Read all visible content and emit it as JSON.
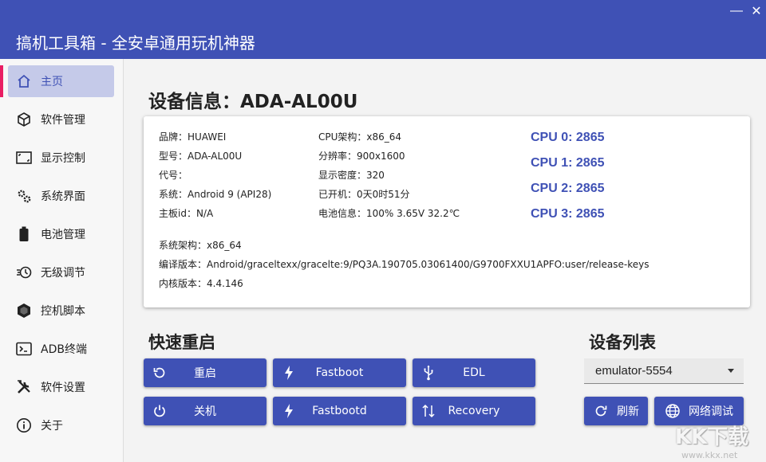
{
  "window": {
    "title": "搞机工具箱 - 全安卓通用玩机神器",
    "minimize_glyph": "—",
    "close_glyph": "✕"
  },
  "sidebar": {
    "items": [
      {
        "label": "主页",
        "icon": "home-icon",
        "active": true
      },
      {
        "label": "软件管理",
        "icon": "box-icon"
      },
      {
        "label": "显示控制",
        "icon": "screen-icon"
      },
      {
        "label": "系统界面",
        "icon": "gears-icon"
      },
      {
        "label": "电池管理",
        "icon": "battery-icon"
      },
      {
        "label": "无级调节",
        "icon": "timer-icon"
      },
      {
        "label": "控机脚本",
        "icon": "hexagon-icon"
      },
      {
        "label": "ADB终端",
        "icon": "terminal-icon"
      },
      {
        "label": "软件设置",
        "icon": "tools-icon"
      },
      {
        "label": "关于",
        "icon": "info-icon"
      }
    ]
  },
  "device": {
    "heading": "设备信息：ADA-AL00U",
    "col1": [
      "品牌：HUAWEI",
      "型号：ADA-AL00U",
      "代号：",
      "系统：Android 9 (API28)",
      "主板id：N/A"
    ],
    "col2": [
      "CPU架构：x86_64",
      "分辨率：900x1600",
      "显示密度：320",
      "已开机：0天0时51分",
      "电池信息：100%  3.65V  32.2℃"
    ],
    "cpus": [
      "CPU 0: 2865",
      "CPU 1: 2865",
      "CPU 2: 2865",
      "CPU 3: 2865"
    ],
    "extra": [
      "系统架构：x86_64",
      "编译版本：Android/graceltexx/gracelte:9/PQ3A.190705.03061400/G9700FXXU1APFO:user/release-keys",
      "内核版本：4.4.146"
    ]
  },
  "reboot": {
    "heading": "快速重启",
    "buttons": {
      "restart": "重启",
      "fastboot": "Fastboot",
      "edl": "EDL",
      "shutdown": "关机",
      "fastbootd": "Fastbootd",
      "recovery": "Recovery"
    }
  },
  "devices": {
    "heading": "设备列表",
    "selected": "emulator-5554",
    "refresh": "刷新",
    "network_debug": "网络调试"
  },
  "watermark": {
    "logo_text": "KK下载",
    "url": "www.kkx.net"
  },
  "colors": {
    "accent": "#3f51b5",
    "active_bg": "#c5cae9",
    "active_mark": "#e91e63"
  }
}
